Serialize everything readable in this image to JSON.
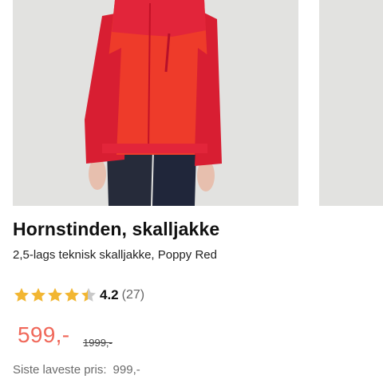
{
  "product": {
    "title": "Hornstinden, skalljakke",
    "description": "2,5-lags teknisk skalljakke, Poppy Red",
    "rating": 4.2,
    "rating_display": "4.2",
    "review_count": "(27)",
    "price": "599,-",
    "old_price": "1999,-",
    "lowest_price_label": "Siste laveste pris:",
    "lowest_price_value": "999,-"
  },
  "colors": {
    "price": "#f0685a",
    "star": "#f2b632",
    "jacket_main": "#ee3b2a",
    "jacket_dark": "#d81e32"
  }
}
